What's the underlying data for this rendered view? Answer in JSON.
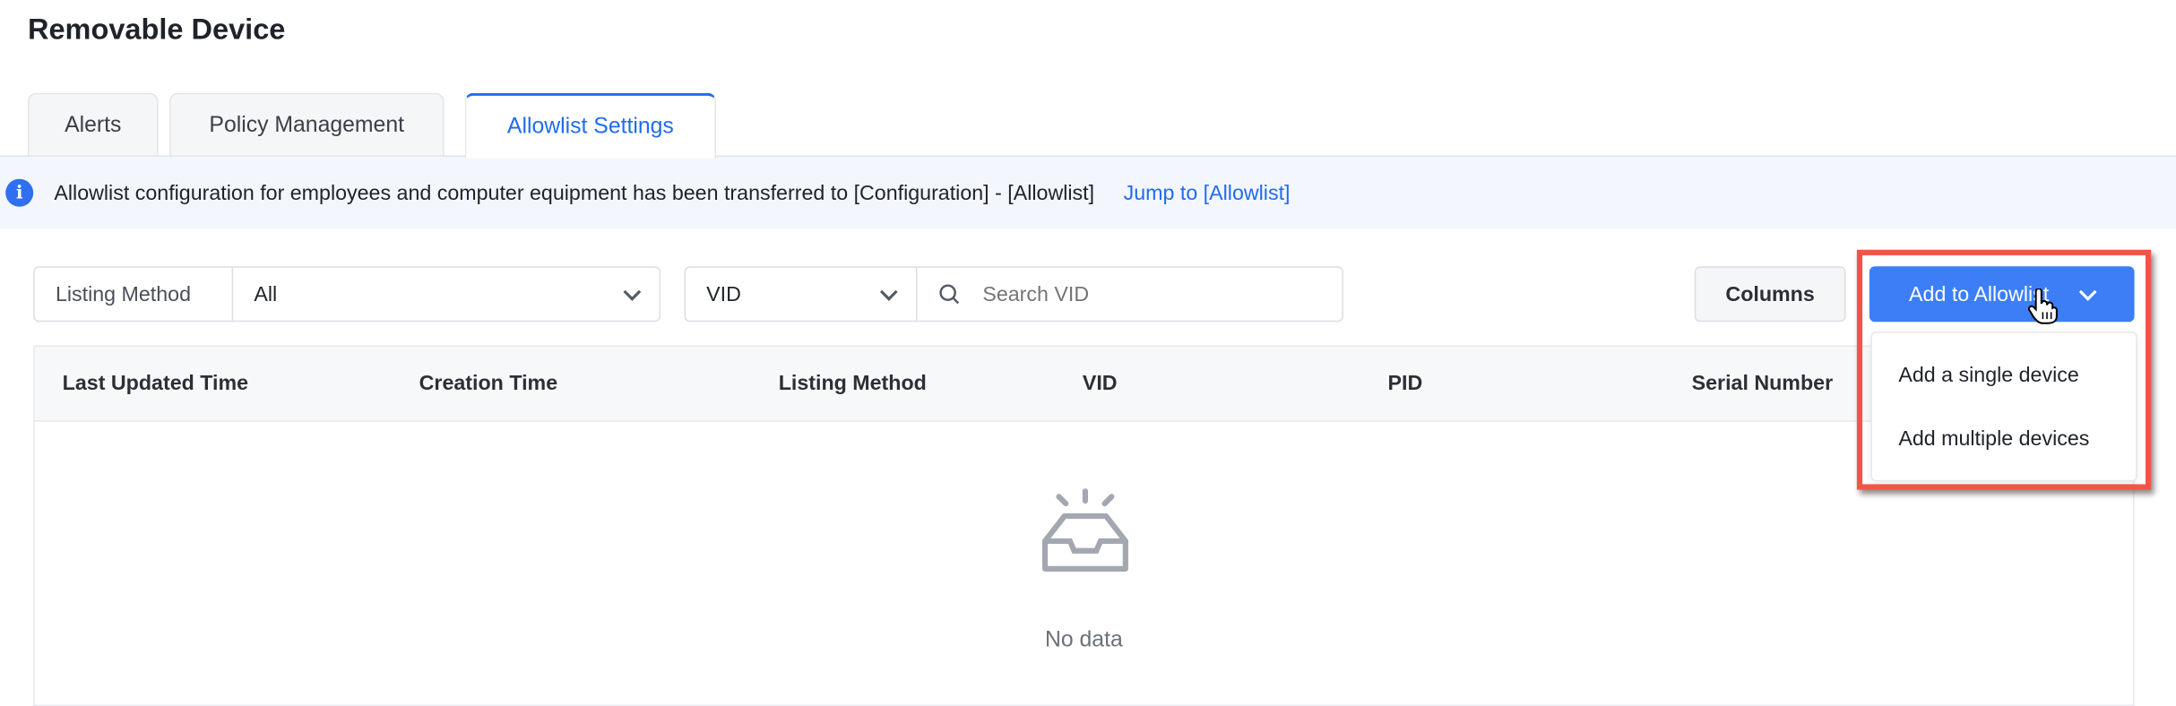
{
  "page": {
    "title": "Removable Device"
  },
  "tabs": [
    {
      "label": "Alerts"
    },
    {
      "label": "Policy Management"
    },
    {
      "label": "Allowlist Settings",
      "active": true
    }
  ],
  "banner": {
    "icon": "info-icon",
    "text": "Allowlist configuration for employees and computer equipment has been transferred to [Configuration] - [Allowlist]",
    "link": "Jump to [Allowlist]"
  },
  "filters": {
    "listing_method": {
      "label": "Listing Method",
      "value": "All"
    },
    "search_field": {
      "value": "VID"
    },
    "search": {
      "placeholder": "Search VID"
    }
  },
  "toolbar": {
    "columns_label": "Columns",
    "add_label": "Add to Allowlist"
  },
  "add_menu": {
    "items": [
      {
        "label": "Add a single device"
      },
      {
        "label": "Add multiple devices"
      }
    ]
  },
  "table": {
    "columns": [
      "Last Updated Time",
      "Creation Time",
      "Listing Method",
      "VID",
      "PID",
      "Serial Number"
    ],
    "rows": [],
    "empty_text": "No data"
  },
  "colors": {
    "accent": "#1f6cf0",
    "button": "#3d7ef7",
    "highlight": "#f25545",
    "banner_bg": "#f3f6fc"
  }
}
